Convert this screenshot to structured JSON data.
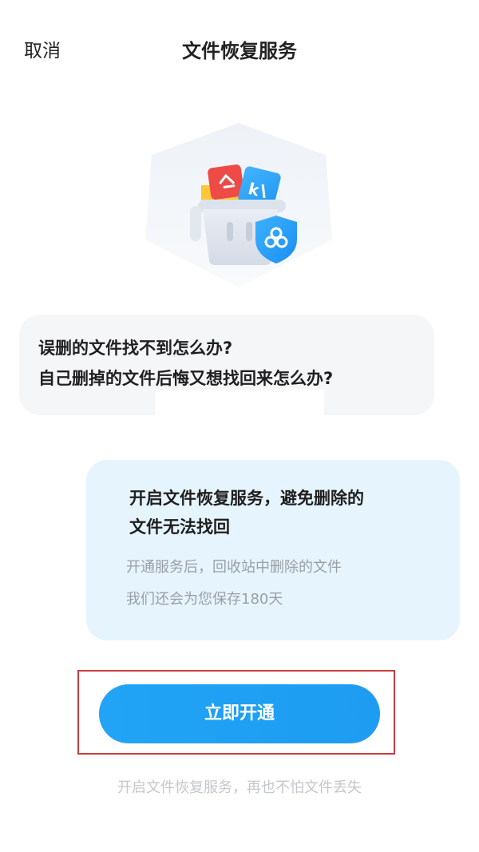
{
  "nav": {
    "cancel_label": "取消",
    "title": "文件恢复服务"
  },
  "question": {
    "line1": "误删的文件找不到怎么办?",
    "line2": "自己删掉的文件后悔又想找回来怎么办?"
  },
  "promo": {
    "headline_line1": "开启文件恢复服务，避免删除的",
    "headline_line2": "文件无法找回",
    "desc_line1": "开通服务后，回收站中删除的文件",
    "desc_line2": "我们还会为您保存180天"
  },
  "cta": {
    "label": "立即开通"
  },
  "footer": {
    "note": "开启文件恢复服务，再也不怕文件丢失"
  },
  "colors": {
    "accent": "#1d9cf2",
    "promo_bg": "#e6f4fd",
    "question_bg": "#f5f6f8",
    "highlight_border": "#c93c3c"
  },
  "icons": {
    "illustration": "trash-bin-with-files-illustration",
    "badge": "shield-cloud-icon"
  }
}
